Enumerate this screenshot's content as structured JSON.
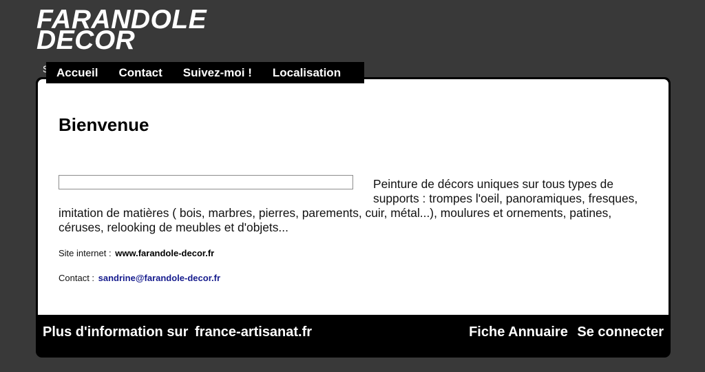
{
  "header": {
    "logo_line1": "FARANDOLE",
    "logo_line2": "DECOR",
    "overlap_char": "S"
  },
  "nav": {
    "items": [
      {
        "label": "Accueil"
      },
      {
        "label": "Contact"
      },
      {
        "label": "Suivez-moi !"
      },
      {
        "label": "Localisation"
      }
    ]
  },
  "main": {
    "title": "Bienvenue",
    "intro": "Peinture de décors uniques sur tous types de supports : trompes l'oeil, panoramiques, fresques, imitation de matières ( bois, marbres, pierres, parements, cuir, métal...), moulures et ornements, patines, céruses, relooking de meubles et d'objets...",
    "site_label": "Site internet :",
    "site_value": "www.farandole-decor.fr",
    "contact_label": "Contact :",
    "contact_value": "sandrine@farandole-decor.fr"
  },
  "footer": {
    "info_text": "Plus d'information sur",
    "info_link": "france-artisanat.fr",
    "fiche_label": "Fiche Annuaire",
    "login_label": "Se connecter"
  }
}
